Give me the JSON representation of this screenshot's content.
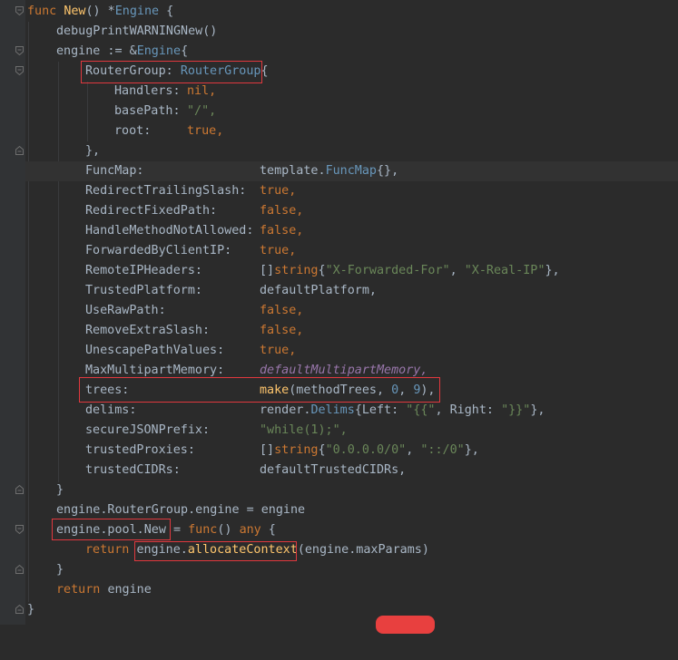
{
  "code": {
    "l1": {
      "func_kw": "func",
      "name": "New",
      "sig": "() *",
      "type": "Engine",
      "brace": " {"
    },
    "l2": {
      "call": "debugPrintWARNINGNew",
      "args": "()"
    },
    "l3": {
      "var": "engine := &",
      "type": "Engine",
      "brace": "{"
    },
    "l4": {
      "field": "RouterGroup:",
      "type": "RouterGroup",
      "brace": "{"
    },
    "l5": {
      "field": "Handlers:",
      "value": "nil,"
    },
    "l6": {
      "field": "basePath:",
      "value": "\"/\","
    },
    "l7": {
      "field": "root:",
      "value": "true,"
    },
    "l8": {
      "text": "},"
    },
    "l9": {
      "field": "FuncMap:",
      "pkg": "template.",
      "type": "FuncMap",
      "rest": "{},"
    },
    "l10": {
      "field": "RedirectTrailingSlash:",
      "value": "true,"
    },
    "l11": {
      "field": "RedirectFixedPath:",
      "value": "false,"
    },
    "l12": {
      "field": "HandleMethodNotAllowed:",
      "value": "false,"
    },
    "l13": {
      "field": "ForwardedByClientIP:",
      "value": "true,"
    },
    "l14": {
      "field": "RemoteIPHeaders:",
      "pre": "[]",
      "type": "string",
      "open": "{",
      "s1": "\"X-Forwarded-For\"",
      "comma": ", ",
      "s2": "\"X-Real-IP\"",
      "close": "},"
    },
    "l15": {
      "field": "TrustedPlatform:",
      "value": "defaultPlatform,"
    },
    "l16": {
      "field": "UseRawPath:",
      "value": "false,"
    },
    "l17": {
      "field": "RemoveExtraSlash:",
      "value": "false,"
    },
    "l18": {
      "field": "UnescapePathValues:",
      "value": "true,"
    },
    "l19": {
      "field": "MaxMultipartMemory:",
      "value": "defaultMultipartMemory,"
    },
    "l20": {
      "field": "trees:",
      "call": "make",
      "open": "(methodTrees, ",
      "n1": "0",
      "comma": ", ",
      "n2": "9",
      "close": "),"
    },
    "l21": {
      "field": "delims:",
      "pkg": "render.",
      "type": "Delims",
      "open": "{Left: ",
      "s1": "\"{{\"",
      "mid": ", Right: ",
      "s2": "\"}}\"",
      "close": "},"
    },
    "l22": {
      "field": "secureJSONPrefix:",
      "value": "\"while(1);\","
    },
    "l23": {
      "field": "trustedProxies:",
      "pre": "[]",
      "type": "string",
      "open": "{",
      "s1": "\"0.0.0.0/0\"",
      "comma": ", ",
      "s2": "\"::/0\"",
      "close": "},"
    },
    "l24": {
      "field": "trustedCIDRs:",
      "value": "defaultTrustedCIDRs,"
    },
    "l25": {
      "text": "}"
    },
    "l26": {
      "text": "engine.RouterGroup.engine = engine"
    },
    "l27": {
      "lhs": "engine.pool.",
      "fld": "New",
      "eq": " = ",
      "func_kw": "func",
      "paren": "() ",
      "any": "any",
      "brace": " {"
    },
    "l28": {
      "ret": "return ",
      "obj": "engine.",
      "call": "allocateContext",
      "args": "(engine.maxParams)"
    },
    "l29": {
      "text": "}"
    },
    "l30": {
      "ret": "return ",
      "obj": "engine"
    },
    "l31": {
      "text": "}"
    }
  },
  "colors": {
    "background": "#2b2b2b",
    "keyword": "#cc7832",
    "function": "#ffc66d",
    "type": "#6897bb",
    "string": "#6a8759",
    "highlight_box": "#e0383e"
  }
}
